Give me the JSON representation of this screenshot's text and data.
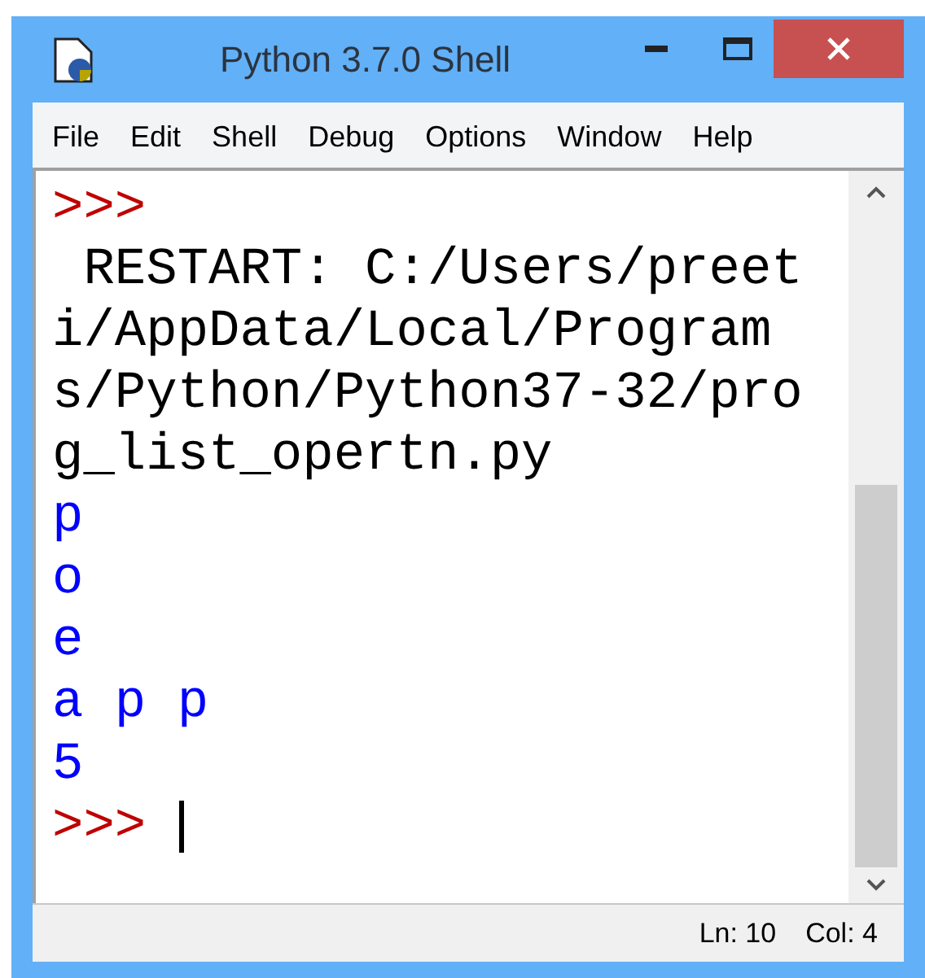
{
  "window": {
    "title": "Python 3.7.0 Shell"
  },
  "menu": [
    "File",
    "Edit",
    "Shell",
    "Debug",
    "Options",
    "Window",
    "Help"
  ],
  "shell_lines": [
    {
      "kind": "prompt",
      "text": ">>>"
    },
    {
      "kind": "message",
      "text": " RESTART: C:/Users/preeti/AppData/Local/Programs/Python/Python37-32/prog_list_opertn.py"
    },
    {
      "kind": "output",
      "text": "p"
    },
    {
      "kind": "output",
      "text": "o"
    },
    {
      "kind": "output",
      "text": "e"
    },
    {
      "kind": "output",
      "text": "a p p"
    },
    {
      "kind": "output",
      "text": "5"
    },
    {
      "kind": "prompt",
      "text": ">>>",
      "cursor": true
    }
  ],
  "status_bar": {
    "line": "Ln: 10",
    "column": "Col: 4"
  }
}
